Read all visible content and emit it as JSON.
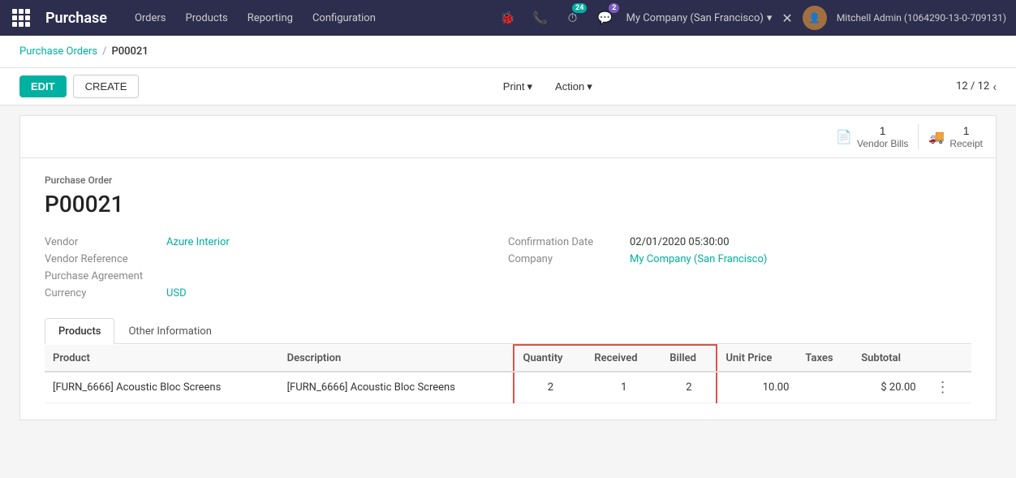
{
  "app": {
    "name": "Purchase"
  },
  "topnav": {
    "links": [
      "Orders",
      "Products",
      "Reporting",
      "Configuration"
    ],
    "notification_count": "24",
    "chat_count": "2",
    "company": "My Company (San Francisco)",
    "user": "Mitchell Admin (1064290-13-0-709131)"
  },
  "breadcrumb": {
    "parent": "Purchase Orders",
    "current": "P00021"
  },
  "toolbar": {
    "edit_label": "EDIT",
    "create_label": "CREATE",
    "print_label": "Print",
    "action_label": "Action",
    "page_current": "12",
    "page_total": "12"
  },
  "document": {
    "type_label": "Purchase Order",
    "id": "P00021",
    "vendor_label": "Vendor",
    "vendor_value": "Azure Interior",
    "vendor_ref_label": "Vendor Reference",
    "purchase_agreement_label": "Purchase Agreement",
    "currency_label": "Currency",
    "currency_value": "USD",
    "confirmation_date_label": "Confirmation Date",
    "confirmation_date_value": "02/01/2020 05:30:00",
    "company_label": "Company",
    "company_value": "My Company (San Francisco)",
    "vendor_bills_count": "1",
    "vendor_bills_label": "Vendor Bills",
    "receipt_count": "1",
    "receipt_label": "Receipt"
  },
  "tabs": [
    {
      "id": "products",
      "label": "Products",
      "active": true
    },
    {
      "id": "other",
      "label": "Other Information",
      "active": false
    }
  ],
  "table": {
    "headers": [
      "Product",
      "Description",
      "Quantity",
      "Received",
      "Billed",
      "Unit Price",
      "Taxes",
      "Subtotal"
    ],
    "rows": [
      {
        "product": "[FURN_6666] Acoustic Bloc Screens",
        "description": "[FURN_6666] Acoustic Bloc Screens",
        "quantity": "2",
        "received": "1",
        "billed": "2",
        "unit_price": "10.00",
        "taxes": "",
        "subtotal": "$ 20.00"
      }
    ]
  }
}
